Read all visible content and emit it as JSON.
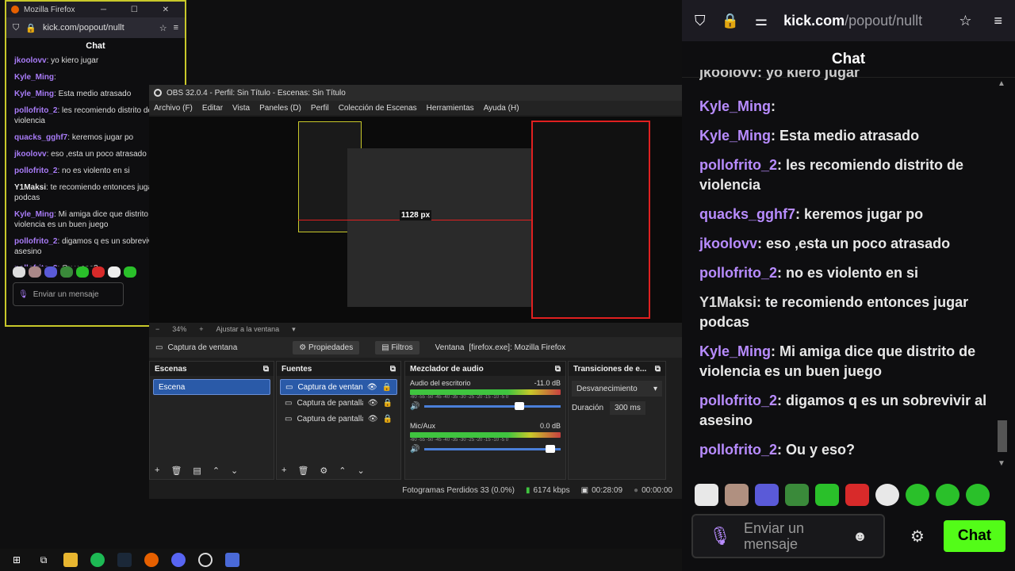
{
  "left_window": {
    "title": "Mozilla Firefox",
    "url": "kick.com/popout/nullt",
    "chat_title": "Chat",
    "messages": [
      {
        "user": "jkoolovv",
        "color": "#a97cf8",
        "text": "yo kiero jugar"
      },
      {
        "user": "Kyle_Ming",
        "color": "#a97cf8",
        "text": ""
      },
      {
        "user": "Kyle_Ming",
        "color": "#a97cf8",
        "text": "Esta medio atrasado"
      },
      {
        "user": "pollofrito_2",
        "color": "#a97cf8",
        "text": "les recomiendo distrito de violencia"
      },
      {
        "user": "quacks_gghf7",
        "color": "#a97cf8",
        "text": "keremos jugar po"
      },
      {
        "user": "jkoolovv",
        "color": "#a97cf8",
        "text": "eso ,esta un poco atrasado"
      },
      {
        "user": "pollofrito_2",
        "color": "#a97cf8",
        "text": "no es violento en si"
      },
      {
        "user": "Y1Maksi",
        "color": "#e8e8e8",
        "text": "te recomiendo entonces jugar podcas"
      },
      {
        "user": "Kyle_Ming",
        "color": "#a97cf8",
        "text": "Mi amiga dice que distrito de violencia es un buen juego"
      },
      {
        "user": "pollofrito_2",
        "color": "#a97cf8",
        "text": "digamos q es un sobrevivir al asesino"
      },
      {
        "user": "pollofrito_2",
        "color": "#a97cf8",
        "text": "Ou y eso?"
      }
    ],
    "input_placeholder": "Enviar un mensaje"
  },
  "obs": {
    "title": "OBS 32.0.4 - Perfil: Sin Título - Escenas: Sin Título",
    "menu": [
      "Archivo (F)",
      "Editar",
      "Vista",
      "Paneles (D)",
      "Perfil",
      "Colección de Escenas",
      "Herramientas",
      "Ayuda (H)"
    ],
    "preview_label": "1128 px",
    "zoom": "34%",
    "fit": "Ajustar a la ventana",
    "source_bar": {
      "name": "Captura de ventana",
      "props": "Propiedades",
      "filters": "Filtros",
      "window_label": "Ventana",
      "window_value": "[firefox.exe]: Mozilla Firefox"
    },
    "scenes": {
      "title": "Escenas",
      "items": [
        "Escena"
      ]
    },
    "sources": {
      "title": "Fuentes",
      "items": [
        "Captura de ventana",
        "Captura de pantalla",
        "Captura de pantalla"
      ]
    },
    "mixer": {
      "title": "Mezclador de audio",
      "channels": [
        {
          "name": "Audio del escritorio",
          "db": "-11.0 dB",
          "level": 0.72
        },
        {
          "name": "Mic/Aux",
          "db": "0.0 dB",
          "level": 0.95
        }
      ],
      "scale": "-60 -55 -50 -45 -40 -35 -30 -25 -20 -15 -10 -5 0"
    },
    "transitions": {
      "title": "Transiciones de e...",
      "value": "Desvanecimiento",
      "duration_label": "Duración",
      "duration": "300 ms"
    },
    "status": {
      "dropped": "Fotogramas Perdidos 33 (0.0%)",
      "kbps": "6174 kbps",
      "rec_time": "00:28:09",
      "stream_time": "00:00:00"
    }
  },
  "right_window": {
    "url_bold": "kick.com",
    "url_rest": "/popout/nullt",
    "chat_title": "Chat",
    "messages": [
      {
        "user": "Kyle_Ming",
        "color": "#b88cff",
        "text": ""
      },
      {
        "user": "Kyle_Ming",
        "color": "#b88cff",
        "text": "Esta medio atrasado"
      },
      {
        "user": "pollofrito_2",
        "color": "#b88cff",
        "text": "les recomiendo distrito de violencia"
      },
      {
        "user": "quacks_gghf7",
        "color": "#b88cff",
        "text": "keremos jugar po"
      },
      {
        "user": "jkoolovv",
        "color": "#b88cff",
        "text": "eso ,esta un poco atrasado"
      },
      {
        "user": "pollofrito_2",
        "color": "#b88cff",
        "text": "no es violento en si"
      },
      {
        "user": "Y1Maksi",
        "color": "#dcdcdc",
        "text": "te recomiendo entonces jugar podcas"
      },
      {
        "user": "Kyle_Ming",
        "color": "#b88cff",
        "text": "Mi amiga dice que distrito de violencia es un buen juego"
      },
      {
        "user": "pollofrito_2",
        "color": "#b88cff",
        "text": "digamos q es un sobrevivir al asesino"
      },
      {
        "user": "pollofrito_2",
        "color": "#b88cff",
        "text": "Ou y eso?"
      }
    ],
    "partial_top": "jkoolovv: yo kiero jugar",
    "input_placeholder": "Enviar un mensaje",
    "send_label": "Chat"
  },
  "colors": {
    "accent": "#53fc18",
    "username": "#b88cff"
  },
  "taskbar_icons": [
    "windows-icon",
    "task-view-icon",
    "file-explorer-icon",
    "spotify-icon",
    "steam-icon",
    "firefox-icon",
    "discord-icon",
    "obs-icon",
    "app-icon"
  ]
}
